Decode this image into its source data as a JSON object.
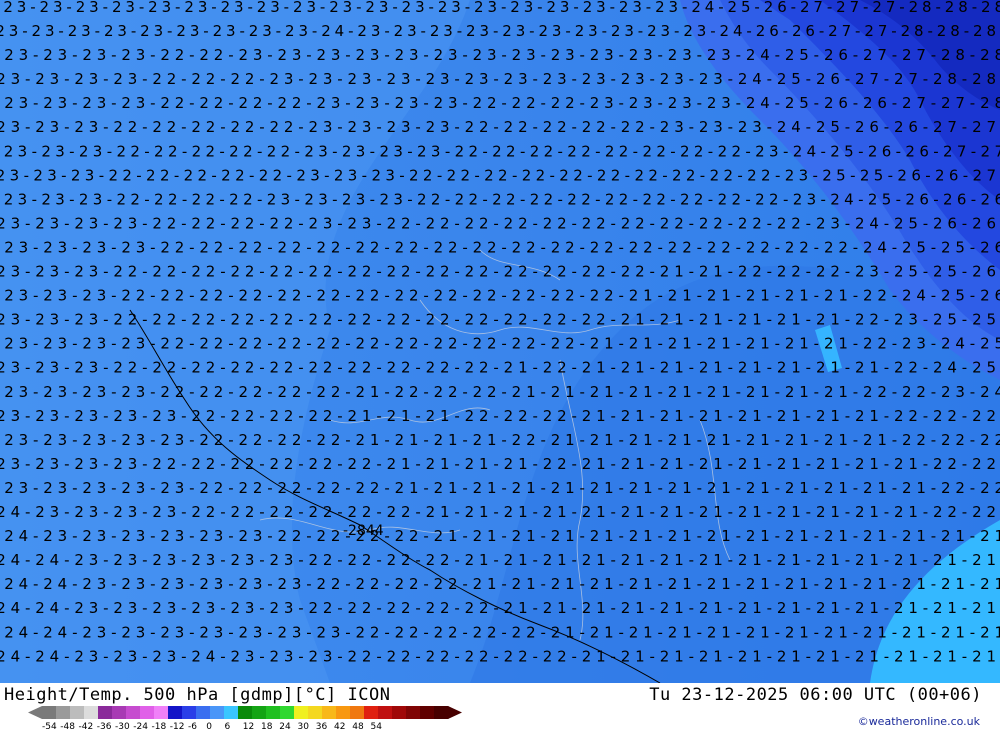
{
  "map": {
    "colors": {
      "band_m23": "#4593f3",
      "band_m22": "#3e89ee",
      "band_m21": "#2f7eea",
      "band_m20": "#35a6ff",
      "band_m24": "#3c70ee",
      "band_m25": "#2f5ee8",
      "band_m26": "#2046df",
      "band_m27": "#1a35d0",
      "band_m28": "#142ac0",
      "band_m19": "#2ccaff",
      "contour_text": "#000000",
      "coast": "#c6cfe0"
    },
    "contour_rows": [
      "23-23-23-23-23-23-23-23-23-23-23-23-23-23-23-23-23-23-23-24-25-26-27-27-27-28-28-28",
      "23-23-23-23-23-23-23-23-23-24-23-23-23-23-23-23-23-23-23-23-24-26-26-27-27-28-28-28",
      "23-23-23-23-22-22-23-23-23-23-23-23-23-23-23-23-23-23-23-24-25-26-27-27-28-28",
      "23-23-23-23-22-22-22-23-23-23-23-23-23-23-23-23-23-23-23-24-25-26-27-27-28-28",
      "23-23-23-23-22-22-22-22-23-23-23-23-22-22-22-23-23-23-23-24-25-26-26-27-27-28",
      "23-23-23-22-22-22-22-22-23-23-23-23-22-22-22-22-22-23-23-23-24-25-26-26-27-27",
      "23-23-23-22-22-22-22-22-23-23-23-23-22-22-22-22-22-22-22-22-23-24-25-26-26-27-27",
      "23-23-23-22-22-22-22-22-23-23-23-22-22-22-22-22-22-22-22-22-22-23-25-25-26-26-27",
      "23-23-23-22-22-22-22-23-23-23-23-22-22-22-22-22-22-22-22-22-22-23-24-25-26-26-26",
      "23-23-23-23-22-22-22-22-23-23-22-22-22-22-22-22-22-22-22-22-22-23-24-25-26-26",
      "23-23-23-23-22-22-22-22-22-22-22-22-22-22-22-22-22-22-22-22-22-22-24-25-25-26",
      "23-23-23-22-22-22-22-22-22-22-22-22-22-22-22-22-22-21-21-22-22-22-23-25-25-26",
      "23-23-23-22-22-22-22-22-22-22-22-22-22-22-22-22-21-21-21-21-21-21-22-24-25-26",
      "23-23-23-22-22-22-22-22-22-22-22-22-22-22-22-22-21-21-21-21-21-21-22-23-25-25",
      "23-23-23-23-22-22-22-22-22-22-22-22-22-22-22-21-21-21-21-21-21-21-22-23-24-25",
      "23-23-23-22-22-22-22-22-22-22-22-22-22-21-22-21-21-21-21-21-21-21-21-22-24-25",
      "23-23-23-23-22-22-22-22-22-21-22-22-22-21-21-21-21-21-21-21-21-21-22-22-23-24",
      "23-23-23-23-23-22-22-22-22-21-21-21-22-22-22-21-21-21-21-21-21-21-21-22-22-22",
      "23-23-23-23-23-22-22-22-22-21-21-21-21-22-21-21-21-21-21-21-21-21-21-22-22-22",
      "23-23-23-23-22-22-22-22-22-22-21-21-21-21-22-21-21-21-21-21-21-21-21-21-22-22",
      "23-23-23-23-23-22-22-22-22-22-21-21-21-21-21-21-21-21-21-21-21-21-21-21-22-22",
      "24-23-23-23-23-22-22-22-22-22-22-21-21-21-21-21-21-21-21-21-21-21-21-21-22-22",
      "24-23-23-23-23-23-23-22-22-22-22-21-21-21-21-21-21-21-21-21-21-21-21-21-21-21",
      "24-24-23-23-23-23-23-23-22-22-22-22-21-21-21-21-21-21-21-21-21-21-21-21-21-21",
      "24-24-23-23-23-23-23-23-22-22-22-22-21-21-21-21-21-21-21-21-21-21-21-21-21-21",
      "24-24-23-23-23-23-23-23-22-22-22-22-22-21-21-21-21-21-21-21-21-21-21-21-21-21",
      "24-24-23-23-23-23-23-23-23-22-22-22-22-22-21-21-21-21-21-21-21-21-21-21-21-21",
      "24-24-23-23-23-24-23-23-23-22-22-22-22-22-22-21-21-21-21-21-21-21-21-21-21-21"
    ],
    "station_label": "-2844"
  },
  "footer": {
    "title": "Height/Temp. 500 hPa [gdmp][°C] ICON",
    "time": "Tu 23-12-2025 06:00 UTC (00+06)",
    "copyright": "©weatheronline.co.uk"
  },
  "legend": {
    "labels": [
      "-54",
      "-48",
      "-42",
      "-36",
      "-30",
      "-24",
      "-18",
      "-12",
      "-6",
      "0",
      "6",
      "12",
      "18",
      "24",
      "30",
      "36",
      "42",
      "48",
      "54"
    ],
    "colors": [
      "#7a7a7a",
      "#9a9a9a",
      "#bcbcbc",
      "#dcdcdc",
      "#8a2a9a",
      "#a83ab4",
      "#c64ccf",
      "#e060e8",
      "#f080f8",
      "#1414c8",
      "#2a3ee8",
      "#3a6ef0",
      "#4a96f8",
      "#3ac6ff",
      "#0a8a0a",
      "#14a414",
      "#20c020",
      "#30d830",
      "#f0f020",
      "#f4d820",
      "#f8b818",
      "#f89810",
      "#f07810",
      "#e02010",
      "#c01010",
      "#a00808",
      "#800404",
      "#600000",
      "#480000"
    ]
  }
}
